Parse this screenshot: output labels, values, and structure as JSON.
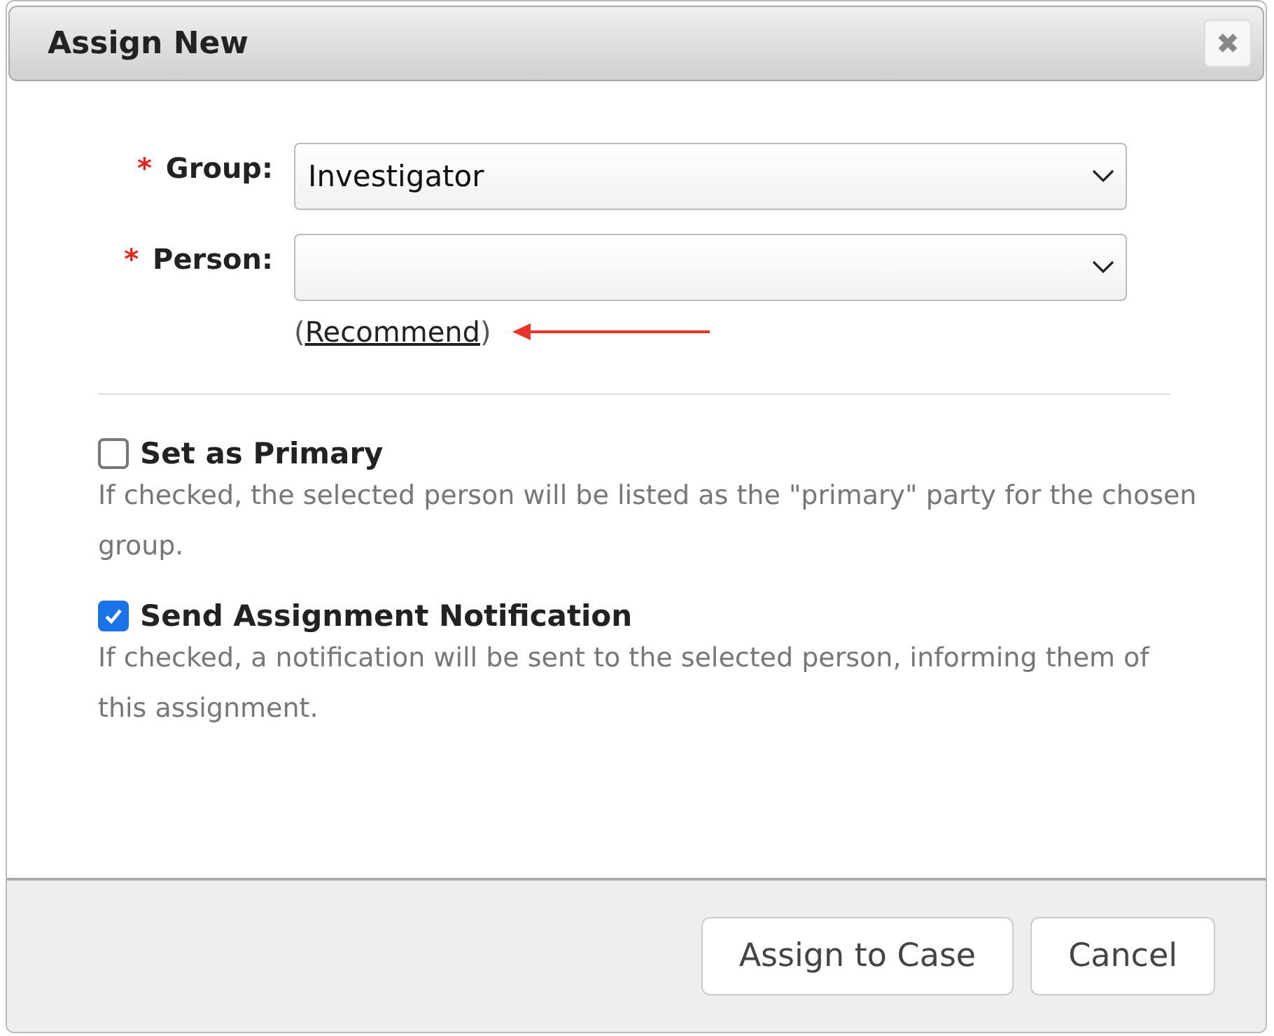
{
  "dialog": {
    "title": "Assign New",
    "close": "✖"
  },
  "fields": [
    {
      "required_mark": "*",
      "label": "Group:",
      "value": "Investigator"
    },
    {
      "required_mark": "*",
      "label": "Person:"
    }
  ],
  "recommend": {
    "before": "(",
    "link": "Recommend",
    "after": ")"
  },
  "options": [
    {
      "label": "Set as Primary",
      "checked": false,
      "description": "If checked, the selected person will be listed as the \"primary\" party for the chosen group."
    },
    {
      "label": "Send Assignment Notification",
      "checked": true,
      "description": "If checked, a notification will be sent to the selected person, informing them of this assignment."
    }
  ],
  "buttons": [
    "Assign to Case",
    "Cancel"
  ]
}
